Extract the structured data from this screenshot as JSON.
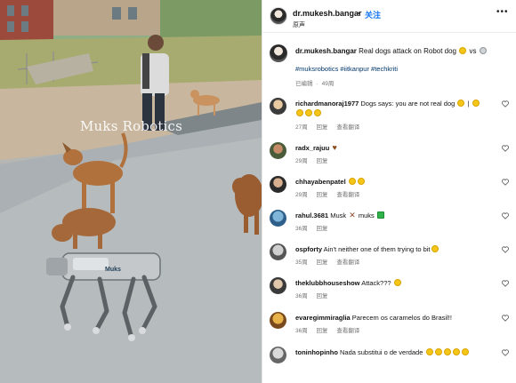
{
  "media": {
    "watermark": "Muks Robotics",
    "robot_label": "Muks"
  },
  "header": {
    "username": "dr.mukesh.bangar",
    "dot": "•",
    "follow_label": "关注",
    "subtitle": "原声",
    "more_icon": "more-icon"
  },
  "caption": {
    "username": "dr.mukesh.bangar",
    "text": "Real dogs attack on Robot dog",
    "vs": "vs",
    "hashtags": "#muksrobotics #iitkanpur #techkriti",
    "edited": "已编辑",
    "dot": "·",
    "age": "49周"
  },
  "comments": [
    {
      "user": "richardmanoraj1977",
      "text": "Dogs says: you are not real dog",
      "extra": "|",
      "age": "27周",
      "reply": "回复",
      "translate": "查看翻译",
      "emoji_count": 3
    },
    {
      "user": "radx_rajuu",
      "text": "",
      "age": "29周",
      "reply": "回复",
      "translate": "",
      "emoji_count": 0
    },
    {
      "user": "chhayabenpatel",
      "text": "",
      "age": "29周",
      "reply": "回复",
      "translate": "查看翻译",
      "emoji_count": 2
    },
    {
      "user": "rahul.3681",
      "text": "Musk",
      "text2": "muks",
      "age": "36周",
      "reply": "回复",
      "translate": "",
      "emoji_count": 0
    },
    {
      "user": "ospforty",
      "text": "Ain't neither one of them trying to bit",
      "age": "35周",
      "reply": "回复",
      "translate": "查看翻译",
      "emoji_count": 1
    },
    {
      "user": "theklubbhouseshow",
      "text": "Attack???",
      "age": "36周",
      "reply": "回复",
      "translate": "",
      "emoji_count": 1
    },
    {
      "user": "evaregimmiraglia",
      "text": "Parecem os caramelos do Brasil!!",
      "age": "36周",
      "reply": "回复",
      "translate": "查看翻译",
      "emoji_count": 0
    },
    {
      "user": "toninhopinho",
      "text": "Nada substitui o de verdade",
      "age": "",
      "reply": "",
      "translate": "",
      "emoji_count": 5
    }
  ],
  "colors": {
    "follow": "#1877f2",
    "hashtag": "#00376b",
    "meta": "#737373"
  }
}
